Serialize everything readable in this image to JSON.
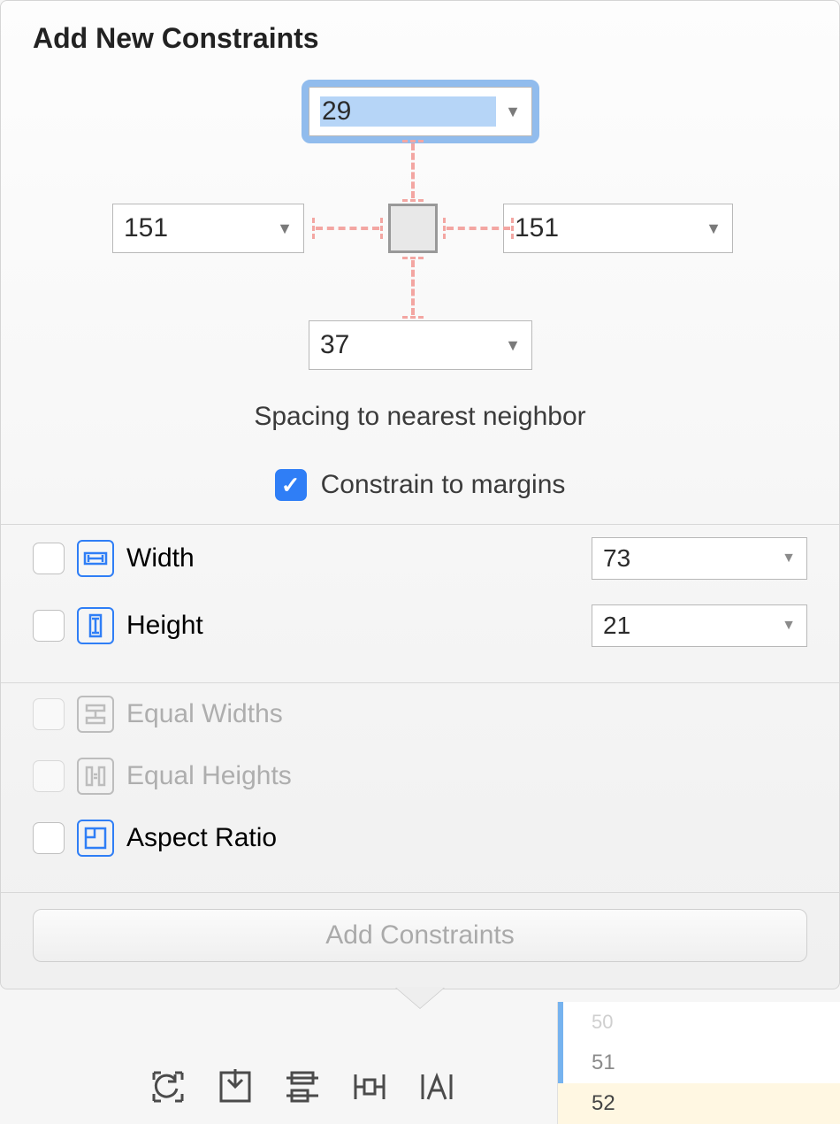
{
  "title": "Add New Constraints",
  "spacing": {
    "top": "29",
    "left": "151",
    "right": "151",
    "bottom": "37",
    "subtitle": "Spacing to nearest neighbor",
    "constrain_label": "Constrain to margins",
    "constrain_checked": true
  },
  "size": {
    "width_label": "Width",
    "width_value": "73",
    "height_label": "Height",
    "height_value": "21"
  },
  "opts": {
    "equal_widths": "Equal Widths",
    "equal_heights": "Equal Heights",
    "aspect_ratio": "Aspect Ratio"
  },
  "add_button": "Add Constraints",
  "lines": {
    "l0": "50",
    "l1": "51",
    "l2": "52"
  }
}
